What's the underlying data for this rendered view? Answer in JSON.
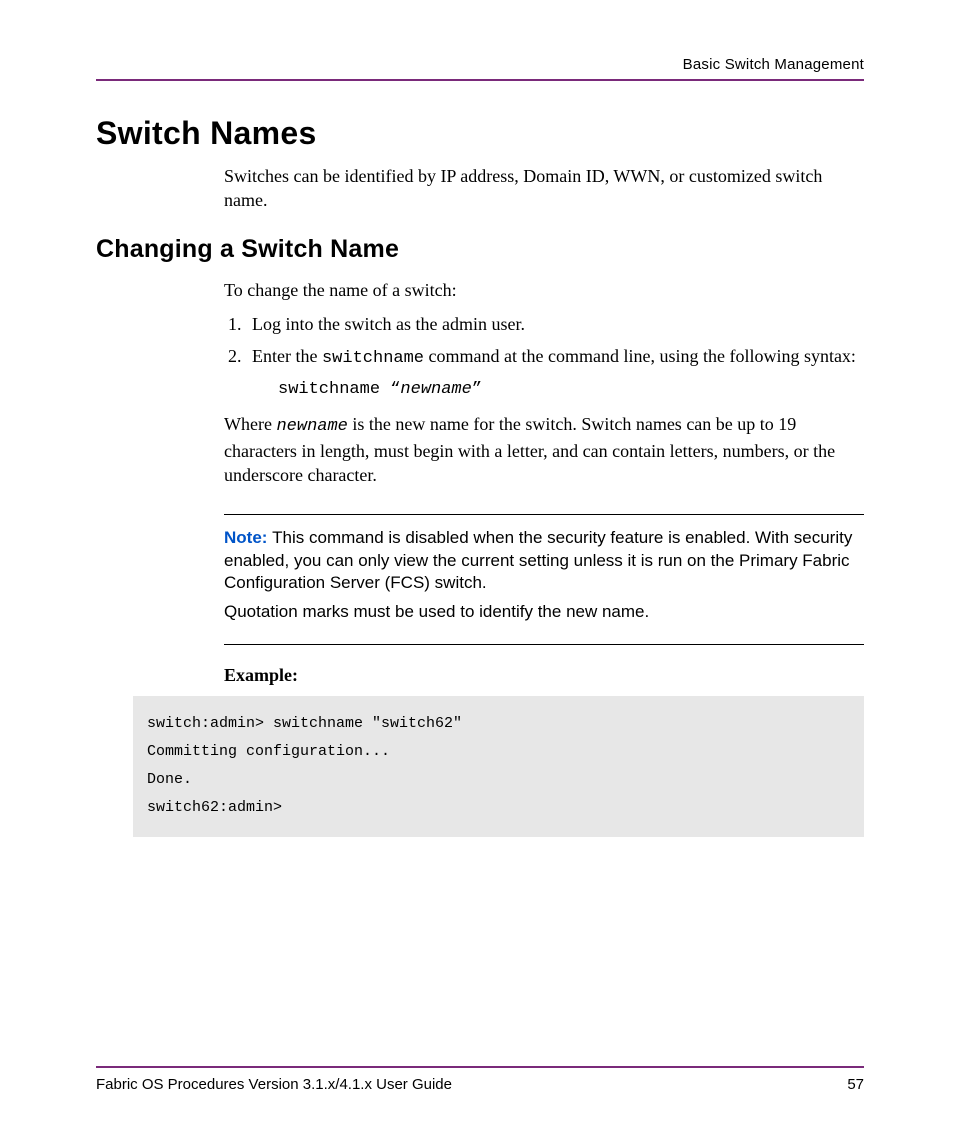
{
  "header": {
    "section": "Basic Switch Management"
  },
  "h1": "Switch Names",
  "intro": "Switches can be identified by IP address, Domain ID, WWN, or customized switch name.",
  "h2": "Changing a Switch Name",
  "lead": "To change the name of a switch:",
  "steps": {
    "s1": "Log into the switch as the admin user.",
    "s2_pre": "Enter the ",
    "s2_cmd": "switchname",
    "s2_post": " command at the command line, using the following syntax:"
  },
  "syntax": {
    "cmd": "switchname ",
    "quote_open": "“",
    "arg": "newname",
    "quote_close": "”"
  },
  "where": {
    "pre": "Where ",
    "arg": "newname",
    "post": " is the new name for the switch. Switch names can be up to 19 characters in length, must begin with a letter, and can contain letters, numbers, or the underscore character."
  },
  "note": {
    "label": "Note:  ",
    "line1": "This command is disabled when the security feature is enabled. With security enabled, you can only view the current setting unless it is run on the Primary Fabric Configuration Server (FCS) switch.",
    "line2": "Quotation marks must be used to identify the new name."
  },
  "example_label": "Example:",
  "code": "switch:admin> switchname \"switch62\"\nCommitting configuration...\nDone.\nswitch62:admin>",
  "footer": {
    "left": "Fabric OS Procedures Version 3.1.x/4.1.x User Guide",
    "right": "57"
  }
}
